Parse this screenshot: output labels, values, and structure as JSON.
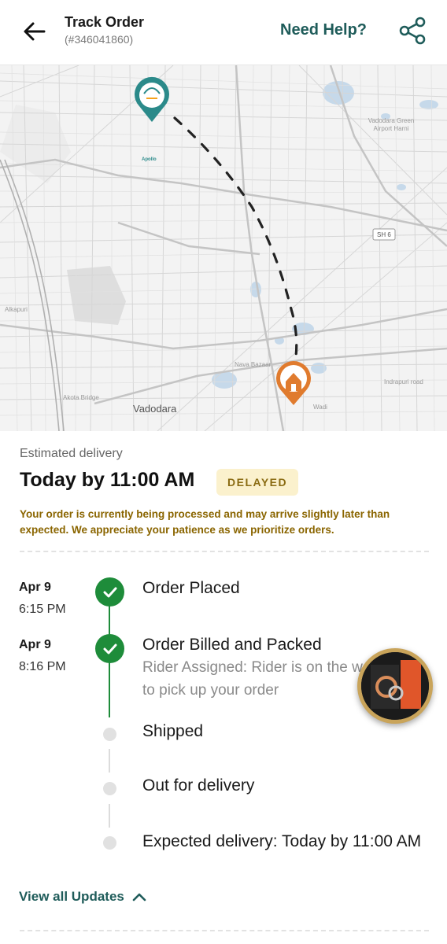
{
  "header": {
    "title": "Track Order",
    "order_id": "(#346041860)",
    "help_label": "Need Help?",
    "back_icon": "arrow-left-icon",
    "share_icon": "share-icon"
  },
  "map": {
    "labels": {
      "city": "Vadodara",
      "airport": "Vadodara Green Airport Harni",
      "sh6": "SH 6",
      "nava_bazaar": "Nava Bazaar",
      "alkapuri": "Alkapuri",
      "akota_bridge": "Akota Bridge",
      "indrapuri": "Indrapuri road",
      "wadi": "Wadi"
    },
    "store_marker": "Apollo",
    "colors": {
      "store_pin": "#2b8a8a",
      "home_pin": "#e07b2e",
      "route": "#222222"
    }
  },
  "delivery": {
    "estimated_label": "Estimated delivery",
    "time": "Today by 11:00 AM",
    "status_badge": "DELAYED",
    "message": "Your order is currently being processed and may arrive slightly later than expected. We appreciate your patience as we prioritize orders."
  },
  "timeline": [
    {
      "date": "Apr 9",
      "time": "6:15 PM",
      "title": "Order Placed",
      "completed": true
    },
    {
      "date": "Apr 9",
      "time": "8:16 PM",
      "title": "Order Billed and Packed",
      "subtitle": "Rider Assigned: Rider is on the way to pick up your order",
      "completed": true
    },
    {
      "title": "Shipped",
      "completed": false
    },
    {
      "title": "Out for delivery",
      "completed": false
    },
    {
      "title": "Expected delivery: Today by 11:00 AM",
      "completed": false
    }
  ],
  "footer": {
    "view_all_label": "View all Updates",
    "chevron_icon": "chevron-up-icon"
  },
  "colors": {
    "accent": "#1f5c5a",
    "success": "#1e8c3a",
    "warning_text": "#8a6500",
    "badge_bg": "#fbf1cd"
  }
}
